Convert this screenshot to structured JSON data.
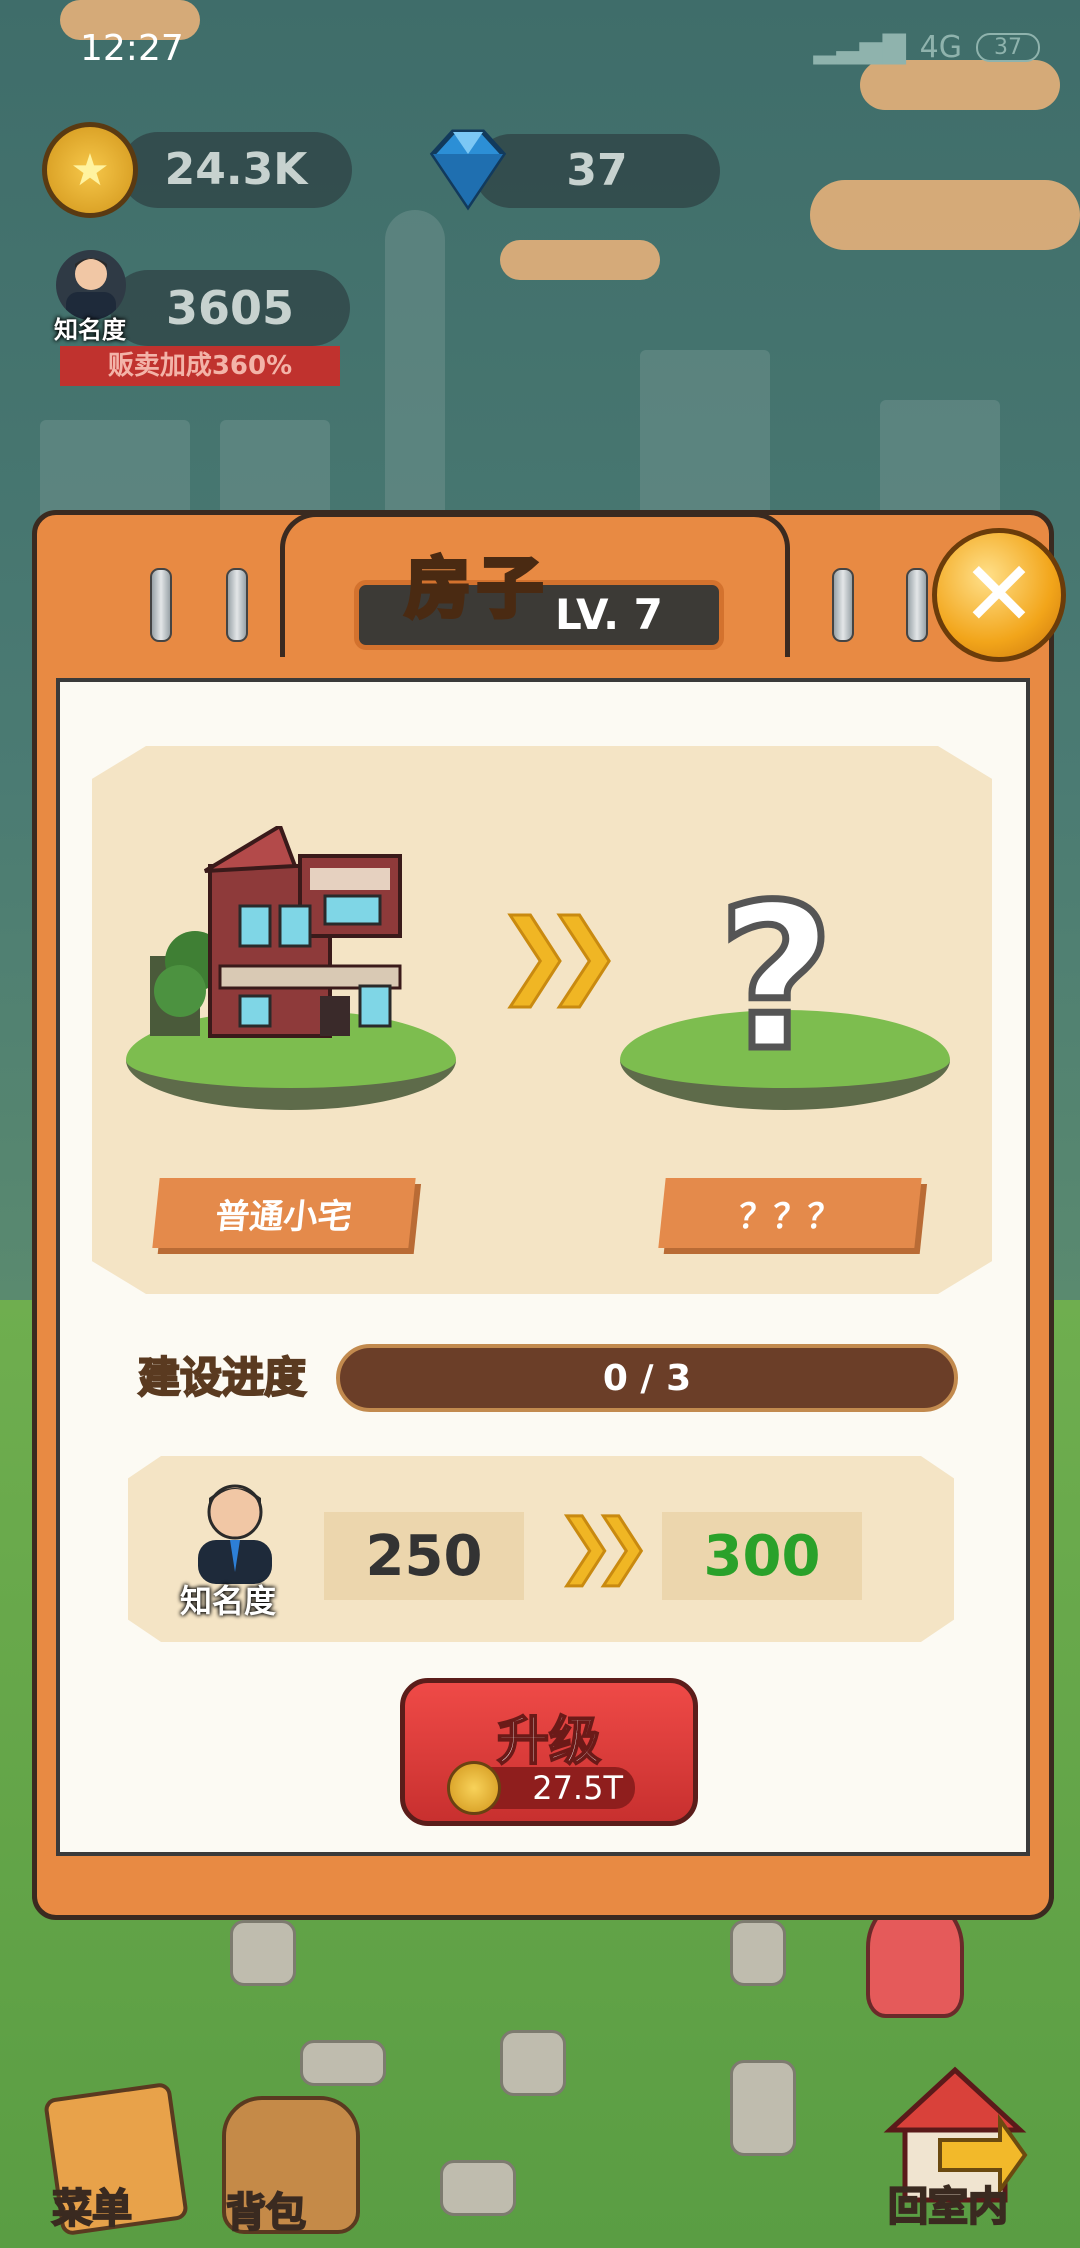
{
  "status_bar": {
    "time": "12:27",
    "network": "4G",
    "battery": "37"
  },
  "resources": {
    "coins": "24.3K",
    "gems": "37"
  },
  "fame": {
    "icon_label": "知名度",
    "value": "3605",
    "bonus": "贩卖加成360%"
  },
  "dialog": {
    "title": "房子",
    "level": "LV. 7",
    "current_name": "普通小宅",
    "next_name": "？？？",
    "progress_label": "建设进度",
    "progress": {
      "current": 0,
      "total": 3,
      "text": "0 / 3"
    },
    "fame_label": "知名度",
    "fame_current": "250",
    "fame_next": "300",
    "upgrade_label": "升级",
    "upgrade_cost": "27.5T"
  },
  "bottom_nav": {
    "menu": "菜单",
    "bag": "背包",
    "home": "回室内"
  },
  "colors": {
    "panel_orange": "#e88a43",
    "accent_green": "#2aa12a",
    "upgrade_red": "#d8383a"
  }
}
